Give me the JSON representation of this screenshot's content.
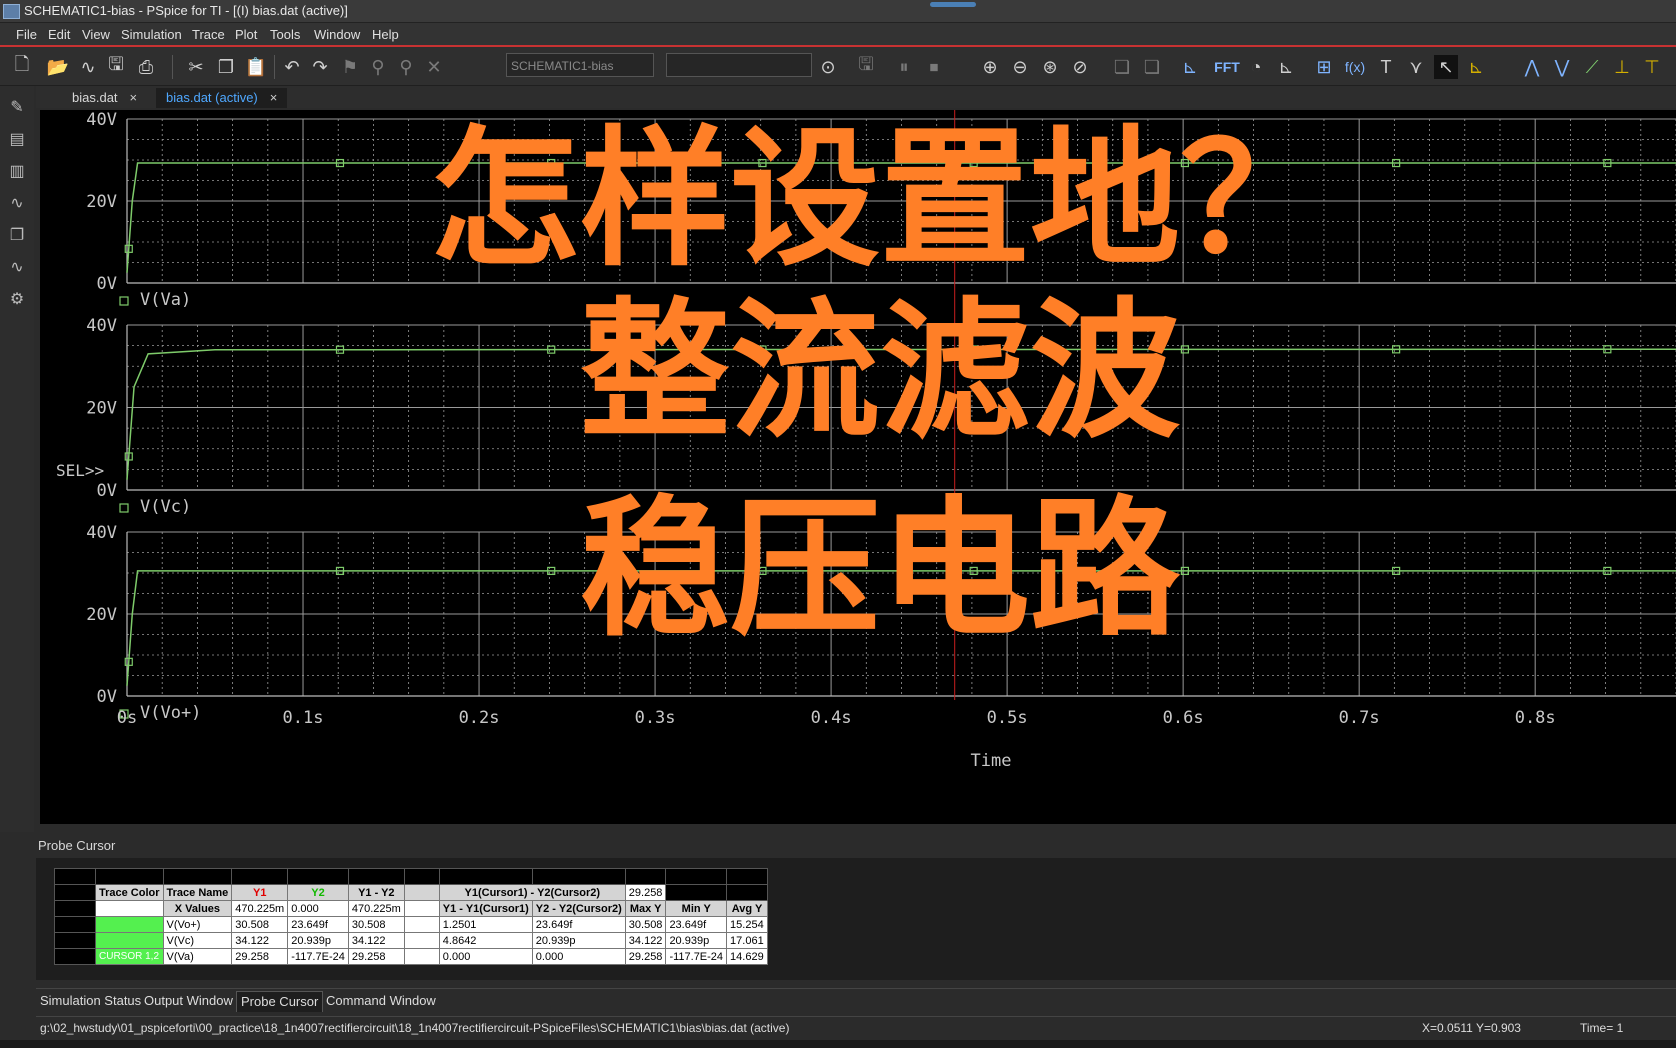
{
  "window": {
    "title": "SCHEMATIC1-bias - PSpice for TI - [(I) bias.dat (active)]"
  },
  "menu": [
    "File",
    "Edit",
    "View",
    "Simulation",
    "Trace",
    "Plot",
    "Tools",
    "Window",
    "Help"
  ],
  "toolbar": {
    "profile_combo": "SCHEMATIC1-bias",
    "fft_label": "FFT",
    "fx_label": "f(x)"
  },
  "tabs": [
    {
      "label": "bias.dat",
      "active": false
    },
    {
      "label": "bias.dat (active)",
      "active": true
    }
  ],
  "plot": {
    "x_axis_label": "Time",
    "selection_marker": "SEL>>",
    "grid_color": "#9a9a9a",
    "trace_color": "#7ecb6a",
    "cursor_color": "#c81e1e",
    "y_tick_labels": [
      "40V",
      "20V",
      "0V"
    ],
    "x_tick_labels": [
      "0s",
      "0.1s",
      "0.2s",
      "0.3s",
      "0.4s",
      "0.5s",
      "0.6s",
      "0.7s",
      "0.8s"
    ],
    "plots": [
      {
        "trace": "V(Va)",
        "settle": 29.258
      },
      {
        "trace": "V(Vc)",
        "settle": 34.122
      },
      {
        "trace": "V(Vo+)",
        "settle": 30.508
      }
    ]
  },
  "chart_data": [
    {
      "type": "line",
      "title": "",
      "xlabel": "",
      "ylabel": "",
      "xlim": [
        0,
        0.88
      ],
      "ylim": [
        0,
        40
      ],
      "grid": true,
      "legend": "bottom-left",
      "series": [
        {
          "name": "V(Va)",
          "x": [
            0,
            0.003,
            0.006,
            0.88
          ],
          "y": [
            2.5,
            20,
            29.258,
            29.258
          ]
        }
      ]
    },
    {
      "type": "line",
      "title": "",
      "xlabel": "",
      "ylabel": "",
      "xlim": [
        0,
        0.88
      ],
      "ylim": [
        0,
        40
      ],
      "grid": true,
      "legend": "bottom-left",
      "series": [
        {
          "name": "V(Vc)",
          "x": [
            0,
            0.004,
            0.012,
            0.05,
            0.88
          ],
          "y": [
            2.5,
            25,
            33,
            34.0,
            34.122
          ]
        }
      ]
    },
    {
      "type": "line",
      "title": "",
      "xlabel": "Time",
      "ylabel": "",
      "xlim": [
        0,
        0.88
      ],
      "ylim": [
        0,
        40
      ],
      "grid": true,
      "legend": "bottom-left",
      "series": [
        {
          "name": "V(Vo+)",
          "x": [
            0,
            0.003,
            0.006,
            0.88
          ],
          "y": [
            2.5,
            20,
            30.508,
            30.508
          ]
        }
      ]
    }
  ],
  "overlay": {
    "line1": "怎样设置地？",
    "line2": "整流滤波",
    "line3": "稳压电路",
    "color": "#ff7f27"
  },
  "probe_cursor": {
    "panel_title": "Probe Cursor",
    "header": [
      "Trace Color",
      "Trace Name",
      "Y1",
      "Y2",
      "Y1 - Y2",
      "",
      "Y1(Cursor1) - Y2(Cursor2)",
      "29.258"
    ],
    "xvalues_row": [
      "X Values",
      "470.225m",
      "0.000",
      "470.225m",
      "",
      "Y1 - Y1(Cursor1)",
      "Y2 - Y2(Cursor2)",
      "Max Y",
      "Min Y",
      "Avg Y"
    ],
    "rows": [
      {
        "color": "",
        "name": "V(Vo+)",
        "y1": "30.508",
        "y2": "23.649f",
        "diff": "30.508",
        "d1": "1.2501",
        "d2": "23.649f",
        "max": "30.508",
        "min": "23.649f",
        "avg": "15.254"
      },
      {
        "color": "",
        "name": "V(Vc)",
        "y1": "34.122",
        "y2": "20.939p",
        "diff": "34.122",
        "d1": "4.8642",
        "d2": "20.939p",
        "max": "34.122",
        "min": "20.939p",
        "avg": "17.061"
      },
      {
        "color": "CURSOR 1,2",
        "name": "V(Va)",
        "y1": "29.258",
        "y2": "-117.7E-24",
        "diff": "29.258",
        "d1": "0.000",
        "d2": "0.000",
        "max": "29.258",
        "min": "-117.7E-24",
        "avg": "14.629"
      }
    ]
  },
  "bottom_tabs": [
    "Simulation Status",
    "Output Window",
    "Probe Cursor",
    "Command Window"
  ],
  "status": {
    "path": "g:\\02_hwstudy\\01_pspiceforti\\00_practice\\18_1n4007rectifiercircuit\\18_1n4007rectifiercircuit-PSpiceFiles\\SCHEMATIC1\\bias\\bias.dat (active)",
    "coords": "X=0.0511  Y=0.903",
    "time": "Time= 1"
  }
}
